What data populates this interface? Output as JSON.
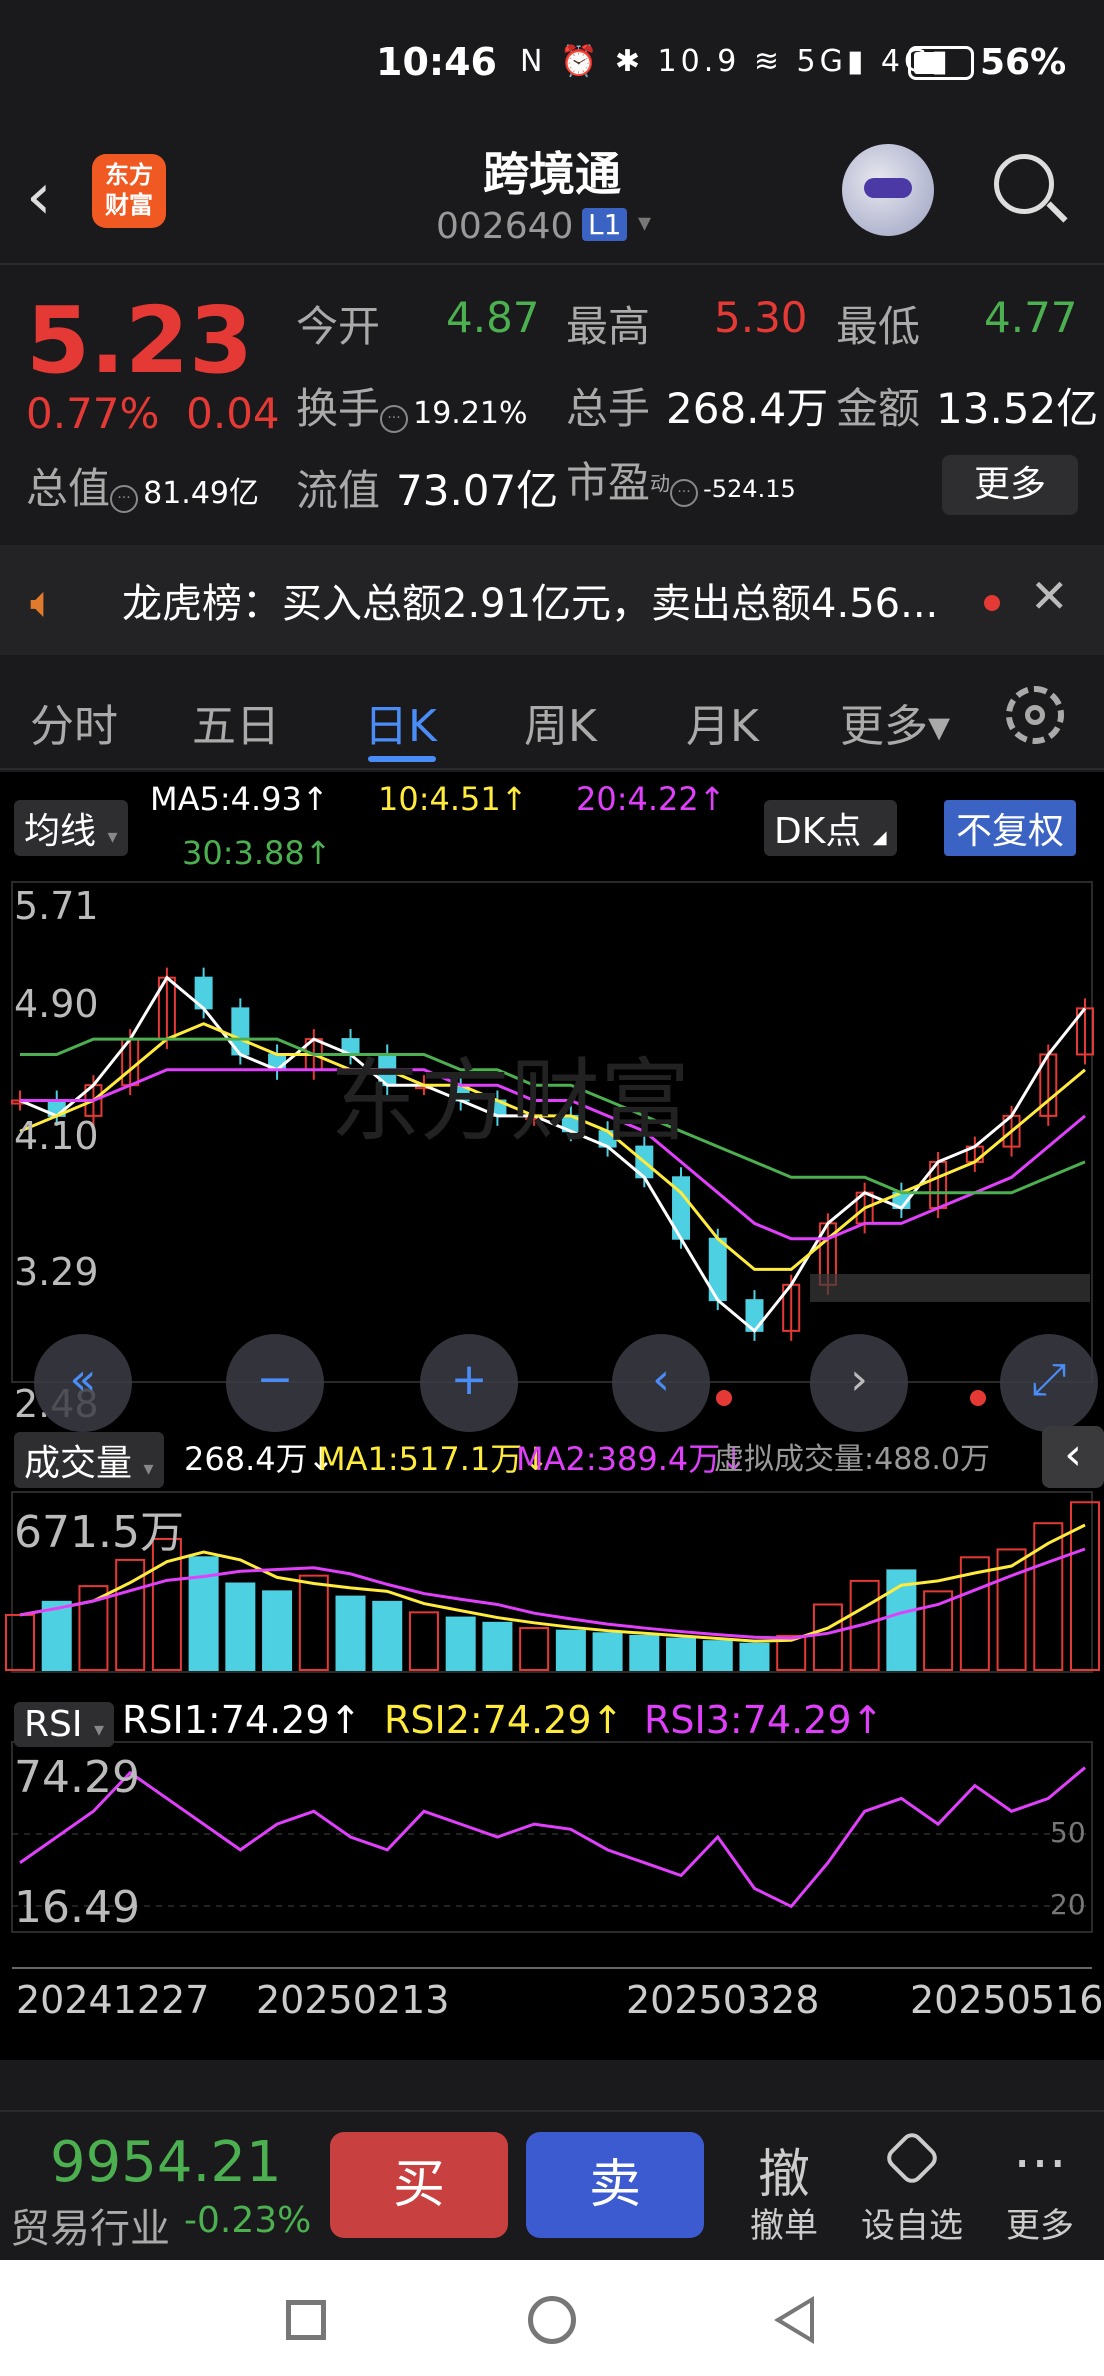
{
  "status": {
    "time": "10:46",
    "icons": "N ⏰ ✱ 10.9 ≋ 5G▮ 4G▮",
    "battery_pct": "56%"
  },
  "header": {
    "stock_name": "跨境通",
    "stock_code": "002640",
    "level": "L1",
    "logo_line1": "东方",
    "logo_line2": "财富"
  },
  "quote": {
    "price": "5.23",
    "change_pct": "0.77%",
    "change_amt": "0.04",
    "open_label": "今开",
    "open": "4.87",
    "high_label": "最高",
    "high": "5.30",
    "low_label": "最低",
    "low": "4.77",
    "turnover_label": "换手",
    "turnover": "19.21%",
    "volume_label": "总手",
    "volume": "268.4万",
    "amount_label": "金额",
    "amount": "13.52亿",
    "mktcap_label": "总值",
    "mktcap": "81.49亿",
    "float_label": "流值",
    "float": "73.07亿",
    "pe_label": "市盈",
    "pe_sup": "动",
    "pe": "-524.15",
    "more": "更多"
  },
  "banner": {
    "text": "龙虎榜：买入总额2.91亿元，卖出总额4.56...",
    "close": "✕"
  },
  "tabs": [
    "分时",
    "五日",
    "日K",
    "周K",
    "月K",
    "更多▾"
  ],
  "active_tab": "日K",
  "kchart": {
    "ma_selector": "均线",
    "ma5": "MA5:4.93↑",
    "ma10": "10:4.51↑",
    "ma20": "20:4.22↑",
    "ma30": "30:3.88↑",
    "dk": "DK点",
    "fq": "不复权",
    "y_labels": [
      "5.71",
      "4.90",
      "4.10",
      "3.29",
      "2.48"
    ],
    "colors": {
      "ma5": "#ffffff",
      "ma10": "#ffeb3b",
      "ma20": "#e040fb",
      "ma30": "#4caf50",
      "up": "#e53935",
      "down": "#4dd0e1"
    },
    "nav_buttons": [
      "«",
      "−",
      "+",
      "‹",
      "›",
      "⤢"
    ]
  },
  "volume": {
    "selector": "成交量",
    "vol": "268.4万↓",
    "ma1": "MA1:517.1万↓",
    "ma2": "MA2:389.4万↓",
    "virtual": "虚拟成交量:488.0万",
    "max_label": "671.5万"
  },
  "rsi": {
    "selector": "RSI",
    "rsi1": "RSI1:74.29↑",
    "rsi2": "RSI2:74.29↑",
    "rsi3": "RSI3:74.29↑",
    "top": "74.29",
    "bottom": "16.49",
    "lvl50": "50",
    "lvl20": "20"
  },
  "dates": [
    "20241227",
    "20250213",
    "20250328",
    "20250516"
  ],
  "chart_data": [
    {
      "type": "line",
      "title": "",
      "ylim": [
        2.48,
        5.71
      ],
      "series": [
        {
          "name": "MA5",
          "values": [
            4.3,
            4.2,
            4.4,
            4.7,
            5.1,
            4.9,
            4.6,
            4.5,
            4.7,
            4.6,
            4.4,
            4.4,
            4.3,
            4.2,
            4.2,
            4.1,
            4.0,
            3.8,
            3.4,
            3.0,
            2.8,
            3.1,
            3.5,
            3.7,
            3.6,
            3.9,
            4.0,
            4.2,
            4.6,
            4.9
          ]
        },
        {
          "name": "10",
          "values": [
            4.1,
            4.2,
            4.3,
            4.5,
            4.7,
            4.8,
            4.7,
            4.6,
            4.6,
            4.5,
            4.5,
            4.4,
            4.4,
            4.3,
            4.2,
            4.2,
            4.1,
            3.9,
            3.7,
            3.4,
            3.2,
            3.2,
            3.4,
            3.6,
            3.7,
            3.8,
            3.9,
            4.1,
            4.3,
            4.5
          ]
        },
        {
          "name": "20",
          "values": [
            4.3,
            4.3,
            4.3,
            4.4,
            4.5,
            4.5,
            4.5,
            4.5,
            4.5,
            4.5,
            4.5,
            4.5,
            4.4,
            4.4,
            4.3,
            4.3,
            4.2,
            4.1,
            3.9,
            3.7,
            3.5,
            3.4,
            3.4,
            3.5,
            3.5,
            3.6,
            3.7,
            3.8,
            4.0,
            4.2
          ]
        },
        {
          "name": "30",
          "values": [
            4.6,
            4.6,
            4.7,
            4.7,
            4.7,
            4.7,
            4.7,
            4.7,
            4.6,
            4.6,
            4.6,
            4.6,
            4.5,
            4.5,
            4.4,
            4.4,
            4.3,
            4.2,
            4.1,
            4.0,
            3.9,
            3.8,
            3.8,
            3.8,
            3.7,
            3.7,
            3.7,
            3.7,
            3.8,
            3.9
          ]
        }
      ]
    },
    {
      "type": "bar",
      "title": "",
      "ylim": [
        0,
        671.5
      ],
      "values": [
        210,
        260,
        320,
        420,
        500,
        430,
        330,
        300,
        360,
        280,
        260,
        220,
        200,
        180,
        160,
        150,
        140,
        130,
        120,
        110,
        100,
        130,
        250,
        340,
        380,
        300,
        430,
        460,
        560,
        640
      ]
    },
    {
      "type": "line",
      "title": "",
      "ylim": [
        16.49,
        74.29
      ],
      "series": [
        {
          "name": "RSI1",
          "values": [
            35,
            45,
            55,
            70,
            60,
            50,
            40,
            50,
            55,
            45,
            40,
            55,
            50,
            45,
            50,
            48,
            40,
            35,
            30,
            45,
            25,
            18,
            35,
            55,
            60,
            50,
            65,
            55,
            60,
            72
          ]
        }
      ]
    }
  ],
  "bottom": {
    "index_value": "9954.21",
    "index_name": "贸易行业",
    "index_chg": "-0.23%",
    "buy": "买",
    "sell": "卖",
    "cancel_icon": "撤",
    "cancel": "撤单",
    "watch": "设自选",
    "more": "更多"
  }
}
